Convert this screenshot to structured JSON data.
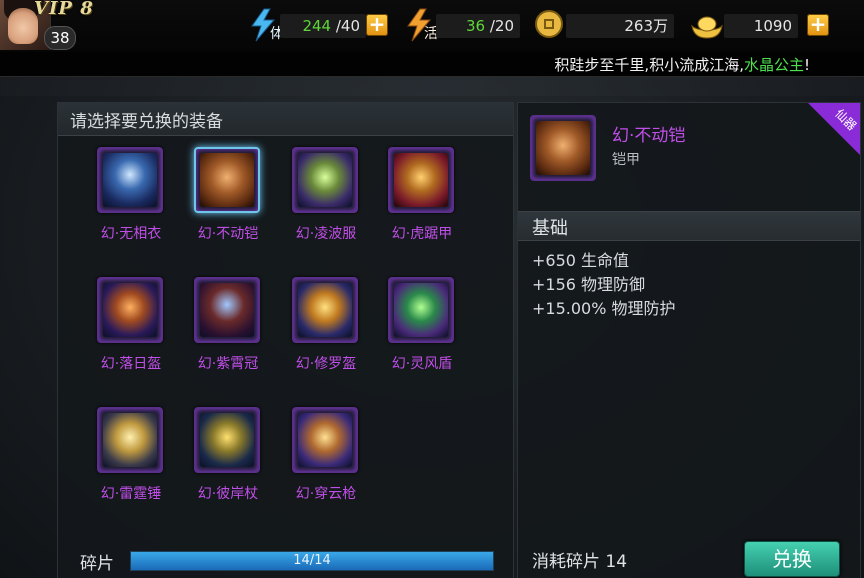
{
  "player": {
    "vip": "VIP 8",
    "level": "38"
  },
  "stats": {
    "stamina": {
      "current": "244",
      "max": " /40",
      "icon_char": "体"
    },
    "vigor": {
      "current": "36",
      "max": " /20",
      "icon_char": "活"
    },
    "coins": {
      "value": "263万"
    },
    "ingots": {
      "value": "1090"
    }
  },
  "marquee": {
    "text": "积跬步至千里,积小流成江海,",
    "highlight": "水晶公主",
    "end": "!"
  },
  "left_panel": {
    "title": "请选择要兑换的装备",
    "items": [
      {
        "label": "幻·无相衣"
      },
      {
        "label": "幻·不动铠"
      },
      {
        "label": "幻·凌波服"
      },
      {
        "label": "幻·虎踞甲"
      },
      {
        "label": "幻·落日盔"
      },
      {
        "label": "幻·紫霄冠"
      },
      {
        "label": "幻·修罗盔"
      },
      {
        "label": "幻·灵风盾"
      },
      {
        "label": "幻·雷霆锤"
      },
      {
        "label": "幻·彼岸杖"
      },
      {
        "label": "幻·穿云枪"
      }
    ],
    "selected_index": 1,
    "progress": {
      "label": "碎片",
      "text": "14/14",
      "fraction": 1.0
    }
  },
  "right_panel": {
    "name": "幻·不动铠",
    "type": "铠甲",
    "badge": "仙器",
    "section": "基础",
    "attributes": [
      "+650 生命值",
      "+156 物理防御",
      "+15.00% 物理防护"
    ],
    "cost": "消耗碎片 14",
    "button": "兑换"
  },
  "colors": {
    "rarity": "#c04ee8",
    "highlight": "#4ee04e",
    "progress": "#3aa8e8",
    "button": "#2bb39a"
  }
}
